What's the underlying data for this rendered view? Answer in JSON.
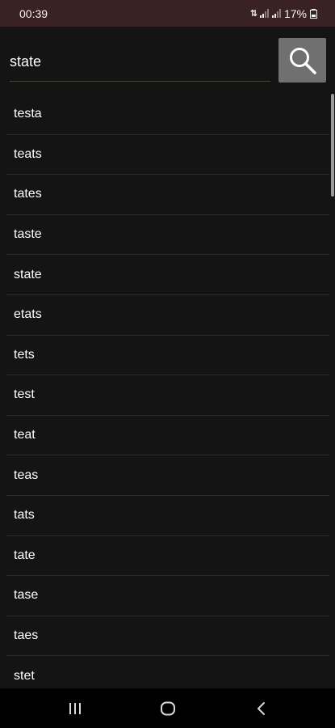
{
  "status_bar": {
    "time": "00:39",
    "battery": "17%",
    "icons": [
      "data-arrows-icon",
      "signal-icon",
      "signal-icon",
      "battery-saver-icon"
    ]
  },
  "search": {
    "value": "state",
    "button_icon": "magnifier-icon"
  },
  "results": [
    {
      "label": "testa"
    },
    {
      "label": "teats"
    },
    {
      "label": "tates"
    },
    {
      "label": "taste"
    },
    {
      "label": "state"
    },
    {
      "label": "etats"
    },
    {
      "label": "tets"
    },
    {
      "label": "test"
    },
    {
      "label": "teat"
    },
    {
      "label": "teas"
    },
    {
      "label": "tats"
    },
    {
      "label": "tate"
    },
    {
      "label": "tase"
    },
    {
      "label": "taes"
    },
    {
      "label": "stet"
    }
  ],
  "nav_bar": {
    "buttons": [
      "recents-icon",
      "home-icon",
      "back-icon"
    ]
  },
  "colors": {
    "status_bar": "#3a2224",
    "background": "#141414",
    "search_button": "#707070",
    "divider": "#2a2a2a"
  }
}
